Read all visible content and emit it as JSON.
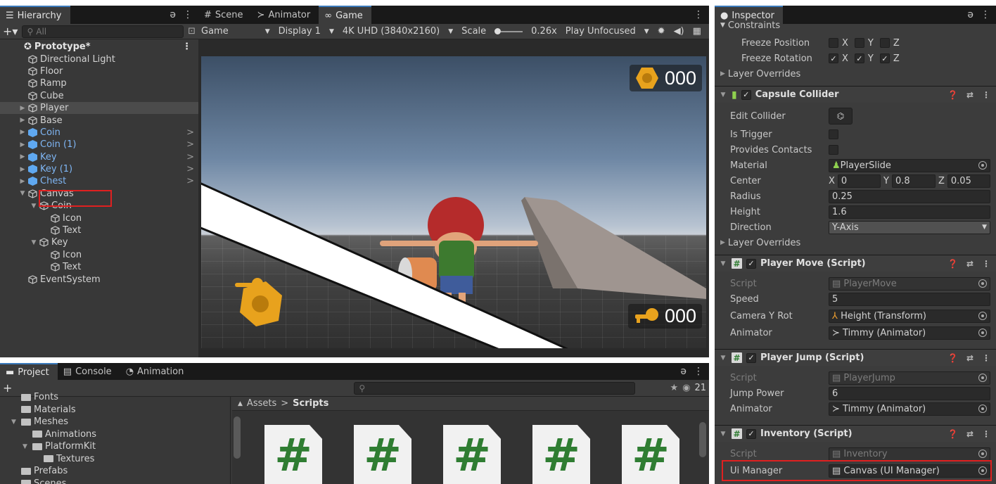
{
  "hierarchy": {
    "tab_label": "Hierarchy",
    "search_placeholder": "All",
    "scene_name": "Prototype*",
    "items": [
      {
        "label": "Directional Light",
        "indent": 1,
        "prefab": false,
        "arrow": ""
      },
      {
        "label": "Floor",
        "indent": 1,
        "prefab": false,
        "arrow": ""
      },
      {
        "label": "Ramp",
        "indent": 1,
        "prefab": false,
        "arrow": ""
      },
      {
        "label": "Cube",
        "indent": 1,
        "prefab": false,
        "arrow": ""
      },
      {
        "label": "Player",
        "indent": 1,
        "prefab": false,
        "arrow": "▶",
        "selected": true
      },
      {
        "label": "Base",
        "indent": 1,
        "prefab": false,
        "arrow": "▶"
      },
      {
        "label": "Coin",
        "indent": 1,
        "prefab": true,
        "arrow": "▶"
      },
      {
        "label": "Coin (1)",
        "indent": 1,
        "prefab": true,
        "arrow": "▶"
      },
      {
        "label": "Key",
        "indent": 1,
        "prefab": true,
        "arrow": "▶"
      },
      {
        "label": "Key (1)",
        "indent": 1,
        "prefab": true,
        "arrow": "▶"
      },
      {
        "label": "Chest",
        "indent": 1,
        "prefab": true,
        "arrow": "▶"
      },
      {
        "label": "Canvas",
        "indent": 1,
        "prefab": false,
        "arrow": "▼"
      },
      {
        "label": "Coin",
        "indent": 2,
        "prefab": false,
        "arrow": "▼"
      },
      {
        "label": "Icon",
        "indent": 3,
        "prefab": false,
        "arrow": ""
      },
      {
        "label": "Text",
        "indent": 3,
        "prefab": false,
        "arrow": ""
      },
      {
        "label": "Key",
        "indent": 2,
        "prefab": false,
        "arrow": "▼"
      },
      {
        "label": "Icon",
        "indent": 3,
        "prefab": false,
        "arrow": ""
      },
      {
        "label": "Text",
        "indent": 3,
        "prefab": false,
        "arrow": ""
      },
      {
        "label": "EventSystem",
        "indent": 1,
        "prefab": false,
        "arrow": ""
      }
    ]
  },
  "game": {
    "tabs": [
      {
        "label": "Scene",
        "icon": "#"
      },
      {
        "label": "Animator",
        "icon": "≻"
      },
      {
        "label": "Game",
        "icon": "∞"
      }
    ],
    "toolbar": {
      "mode": "Game",
      "display": "Display 1",
      "resolution": "4K UHD (3840x2160)",
      "scale_label": "Scale",
      "scale_value": "0.26x",
      "play_mode": "Play Unfocused"
    },
    "hud": {
      "coin_count": "000",
      "key_count": "000"
    }
  },
  "project": {
    "tabs": [
      "Project",
      "Console",
      "Animation"
    ],
    "badge_count": "21",
    "folders": [
      {
        "label": "Fonts",
        "indent": 1,
        "arrow": ""
      },
      {
        "label": "Materials",
        "indent": 1,
        "arrow": ""
      },
      {
        "label": "Meshes",
        "indent": 1,
        "arrow": "▼"
      },
      {
        "label": "Animations",
        "indent": 2,
        "arrow": ""
      },
      {
        "label": "PlatformKit",
        "indent": 2,
        "arrow": "▼"
      },
      {
        "label": "Textures",
        "indent": 3,
        "arrow": ""
      },
      {
        "label": "Prefabs",
        "indent": 1,
        "arrow": ""
      },
      {
        "label": "Scenes",
        "indent": 1,
        "arrow": ""
      }
    ],
    "breadcrumb": {
      "root": "Assets",
      "current": "Scripts"
    },
    "script_count": 5
  },
  "inspector": {
    "tab_label": "Inspector",
    "constraints_label": "Constraints",
    "freeze_position_label": "Freeze Position",
    "freeze_rotation_label": "Freeze Rotation",
    "layer_overrides_label": "Layer Overrides",
    "capsule_collider": {
      "title": "Capsule Collider",
      "edit_collider_label": "Edit Collider",
      "is_trigger_label": "Is Trigger",
      "provides_contacts_label": "Provides Contacts",
      "material_label": "Material",
      "material_value": "PlayerSlide",
      "center_label": "Center",
      "center_x": "0",
      "center_y": "0.8",
      "center_z": "0.05",
      "radius_label": "Radius",
      "radius_value": "0.25",
      "height_label": "Height",
      "height_value": "1.6",
      "direction_label": "Direction",
      "direction_value": "Y-Axis"
    },
    "player_move": {
      "title": "Player Move (Script)",
      "script_label": "Script",
      "script_value": "PlayerMove",
      "speed_label": "Speed",
      "speed_value": "5",
      "camera_label": "Camera Y Rot",
      "camera_value": "Height (Transform)",
      "animator_label": "Animator",
      "animator_value": "Timmy (Animator)"
    },
    "player_jump": {
      "title": "Player Jump (Script)",
      "script_label": "Script",
      "script_value": "PlayerJump",
      "jump_label": "Jump Power",
      "jump_value": "6",
      "animator_label": "Animator",
      "animator_value": "Timmy (Animator)"
    },
    "inventory": {
      "title": "Inventory (Script)",
      "script_label": "Script",
      "script_value": "Inventory",
      "ui_manager_label": "Ui Manager",
      "ui_manager_value": "Canvas (UI Manager)"
    }
  },
  "axis": {
    "x": "X",
    "y": "Y",
    "z": "Z"
  },
  "colors": {
    "highlight": "#e02020",
    "prefab": "#7fb6f4",
    "script_green": "#2f7d32"
  }
}
